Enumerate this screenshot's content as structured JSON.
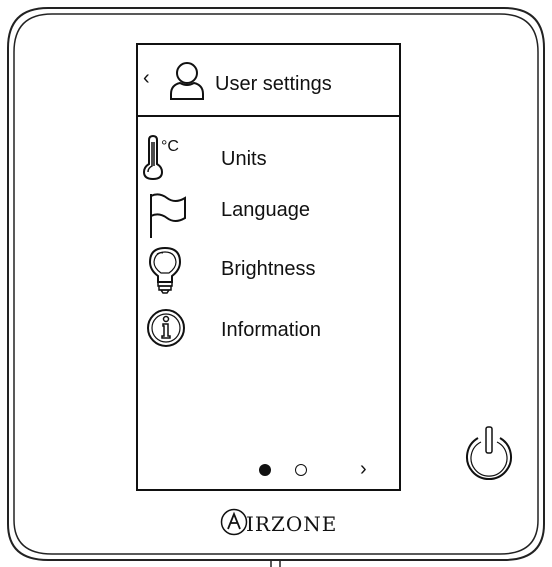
{
  "header": {
    "back_icon": "chevron-left-icon",
    "back_glyph": "‹",
    "user_icon": "user-icon",
    "title": "User settings"
  },
  "menu": {
    "items": [
      {
        "label": "Units",
        "icon": "thermometer-icon",
        "unit_symbol": "°C"
      },
      {
        "label": "Language",
        "icon": "flag-icon"
      },
      {
        "label": "Brightness",
        "icon": "lightbulb-icon"
      },
      {
        "label": "Information",
        "icon": "info-icon"
      }
    ]
  },
  "pager": {
    "current_page": 1,
    "total_pages": 2,
    "next_icon": "chevron-right-icon",
    "next_glyph": "›"
  },
  "brand": {
    "logo_text": "AIRZONE"
  },
  "power": {
    "icon": "power-icon"
  }
}
